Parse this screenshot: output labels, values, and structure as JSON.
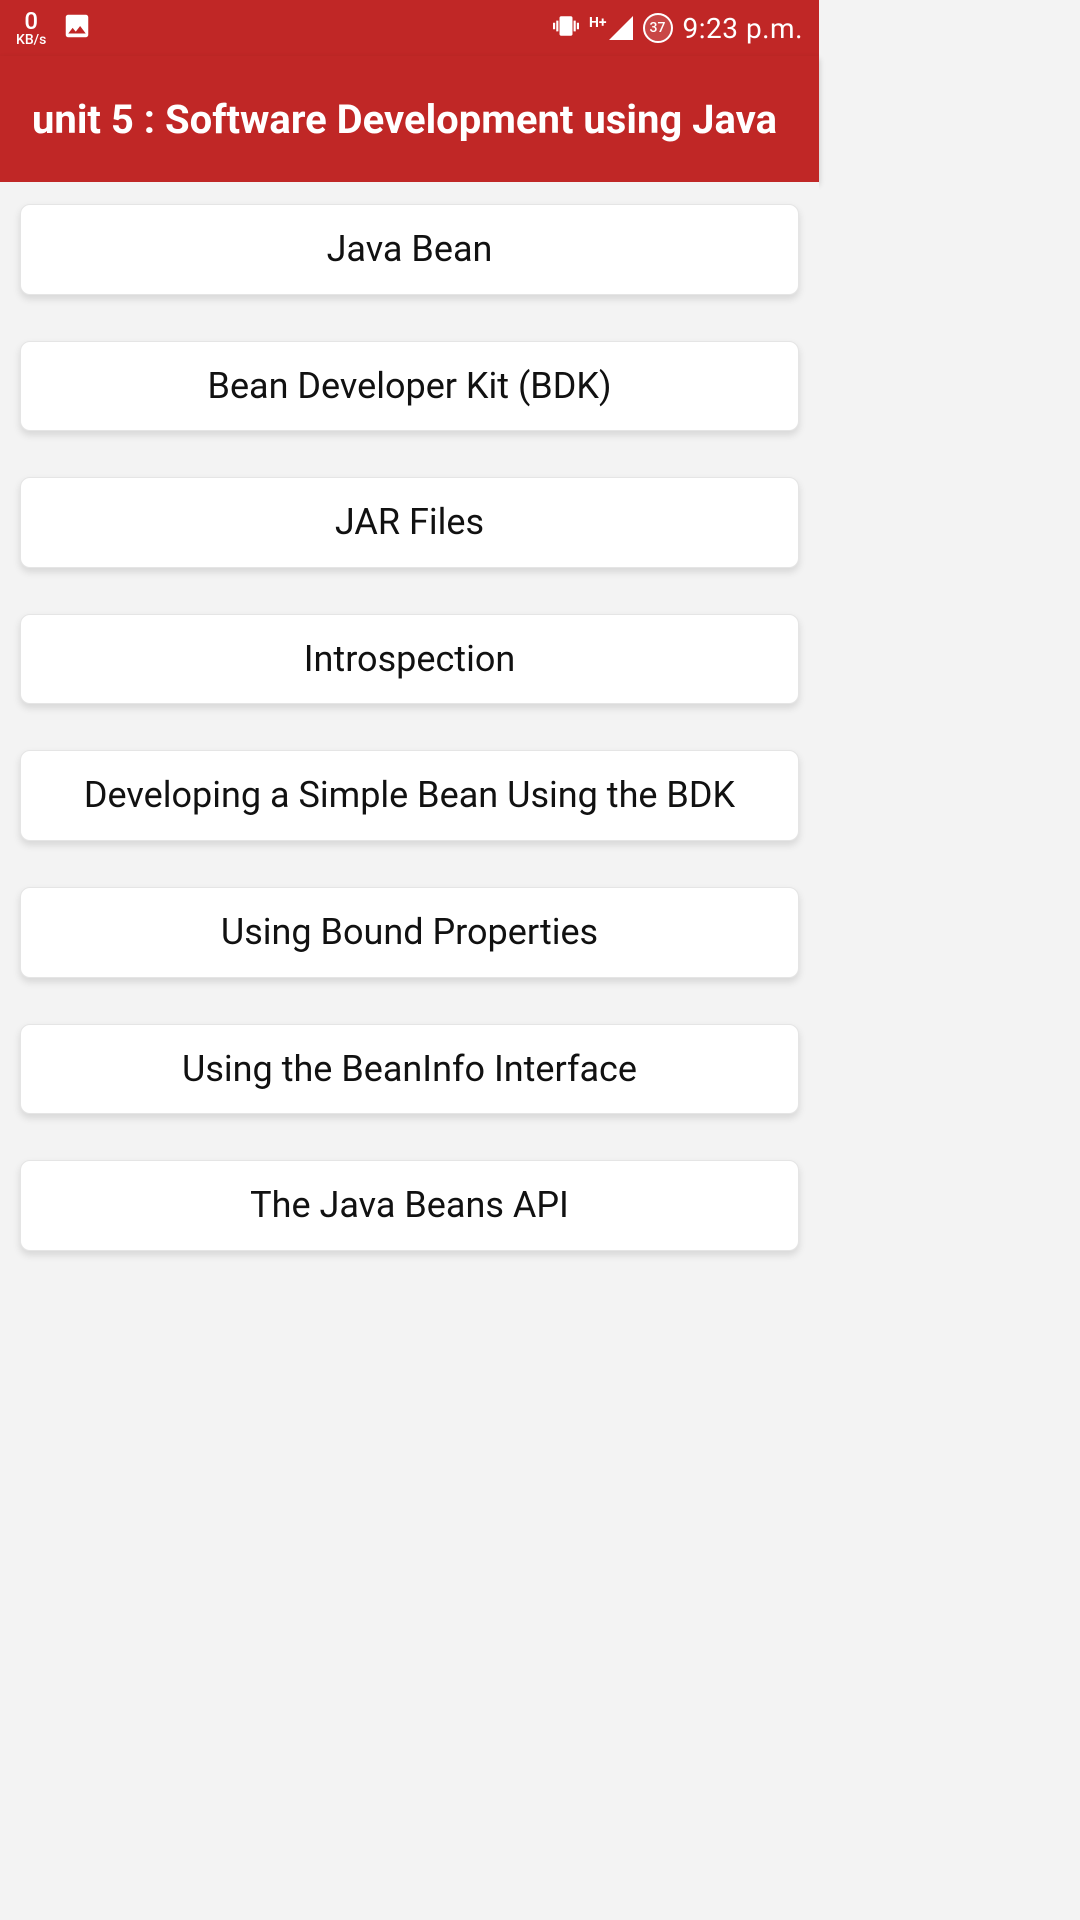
{
  "status_bar": {
    "speed_value": "0",
    "speed_unit": "KB/s",
    "network_label": "H+",
    "battery_percent": "37",
    "time": "9:23 p.m."
  },
  "header": {
    "title": "unit 5 : Software Development using Java"
  },
  "topics": [
    {
      "label": "Java Bean"
    },
    {
      "label": "Bean Developer Kit (BDK)"
    },
    {
      "label": "JAR Files"
    },
    {
      "label": "Introspection"
    },
    {
      "label": "Developing a Simple Bean Using the BDK"
    },
    {
      "label": "Using Bound Properties"
    },
    {
      "label": "Using the BeanInfo Interface"
    },
    {
      "label": "The Java Beans API"
    }
  ]
}
